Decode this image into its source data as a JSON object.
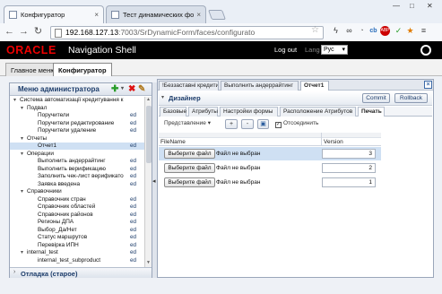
{
  "browser": {
    "tabs": [
      {
        "title": "Конфигуратор",
        "active": true
      },
      {
        "title": "Тест динамических форм",
        "active": false
      }
    ],
    "url_host": "192.168.127.13",
    "url_path": ":7003/SrDynamicForm/faces/configurato"
  },
  "header": {
    "brand": "ORACLE",
    "app_name": "Navigation Shell",
    "logout": "Log out",
    "lang_label": "Lang",
    "lang_value": "Рус"
  },
  "app_tabs": [
    {
      "label": "Главное меню",
      "active": false
    },
    {
      "label": "Конфигуратор",
      "active": true
    }
  ],
  "admin_menu": {
    "title": "Меню администратора",
    "tree": [
      {
        "label": "Система автоматизації кредитування к",
        "level": 0,
        "type": "open",
        "ed": ""
      },
      {
        "label": "Подвал",
        "level": 1,
        "type": "open",
        "ed": ""
      },
      {
        "label": "Поручители",
        "level": 2,
        "type": "leaf",
        "ed": "ed"
      },
      {
        "label": "Поручители редактирование",
        "level": 2,
        "type": "leaf",
        "ed": "ed"
      },
      {
        "label": "Поручители удаление",
        "level": 2,
        "type": "leaf",
        "ed": "ed"
      },
      {
        "label": "Отчеты",
        "level": 1,
        "type": "open",
        "ed": ""
      },
      {
        "label": "Отчет1",
        "level": 2,
        "type": "leaf",
        "ed": "ed",
        "selected": true
      },
      {
        "label": "Операции",
        "level": 1,
        "type": "open",
        "ed": ""
      },
      {
        "label": "Выполнить андеррайтинг",
        "level": 2,
        "type": "leaf",
        "ed": "ed"
      },
      {
        "label": "Выполнить верификацию",
        "level": 2,
        "type": "leaf",
        "ed": "ed"
      },
      {
        "label": "Заполнить чек-лист верификато",
        "level": 2,
        "type": "leaf",
        "ed": "ed"
      },
      {
        "label": "Заявка введена",
        "level": 2,
        "type": "leaf",
        "ed": "ed"
      },
      {
        "label": "Справочники",
        "level": 1,
        "type": "open",
        "ed": ""
      },
      {
        "label": "Справочник стран",
        "level": 2,
        "type": "leaf",
        "ed": "ed"
      },
      {
        "label": "Справочник областей",
        "level": 2,
        "type": "leaf",
        "ed": "ed"
      },
      {
        "label": "Справочник районов",
        "level": 2,
        "type": "leaf",
        "ed": "ed"
      },
      {
        "label": "Регионы ДПА",
        "level": 2,
        "type": "leaf",
        "ed": "ed"
      },
      {
        "label": "Выбор_Да/Нет",
        "level": 2,
        "type": "leaf",
        "ed": "ed"
      },
      {
        "label": "Статус маршрутов",
        "level": 2,
        "type": "leaf",
        "ed": "ed"
      },
      {
        "label": "Перевірка ИПН",
        "level": 2,
        "type": "leaf",
        "ed": "ed"
      },
      {
        "label": "internal_test",
        "level": 1,
        "type": "open",
        "ed": "ed"
      },
      {
        "label": "internal_test_subproduct",
        "level": 2,
        "type": "leaf",
        "ed": "ed"
      }
    ],
    "footer": "Отладка (старое)"
  },
  "doc_tabs": [
    {
      "label": "!Беззаставні кредити",
      "active": false
    },
    {
      "label": "Выполнить андеррайтинг",
      "active": false
    },
    {
      "label": "Отчет1",
      "active": true
    }
  ],
  "designer": {
    "title": "Дизайнер",
    "commit": "Commit",
    "rollback": "Rollback"
  },
  "sub_tabs": [
    {
      "label": "Базовые",
      "active": false
    },
    {
      "label": "Атрибуты",
      "active": false
    },
    {
      "label": "Настройки формы",
      "active": false
    },
    {
      "label": "Расположение Атрибутов",
      "active": false
    },
    {
      "label": "Печать",
      "active": true
    }
  ],
  "toolbar": {
    "view": "Представление",
    "add": "+",
    "remove": "-",
    "detach": "Отсоединить"
  },
  "table": {
    "columns": [
      "FileName",
      "Version"
    ],
    "rows": [
      {
        "button": "Выберите файл",
        "file": "Файл не выбран",
        "version": "3",
        "selected": true
      },
      {
        "button": "Выберите файл",
        "file": "Файл не выбран",
        "version": "2",
        "selected": false
      },
      {
        "button": "Выберите файл",
        "file": "Файл не выбран",
        "version": "1",
        "selected": false
      }
    ]
  }
}
